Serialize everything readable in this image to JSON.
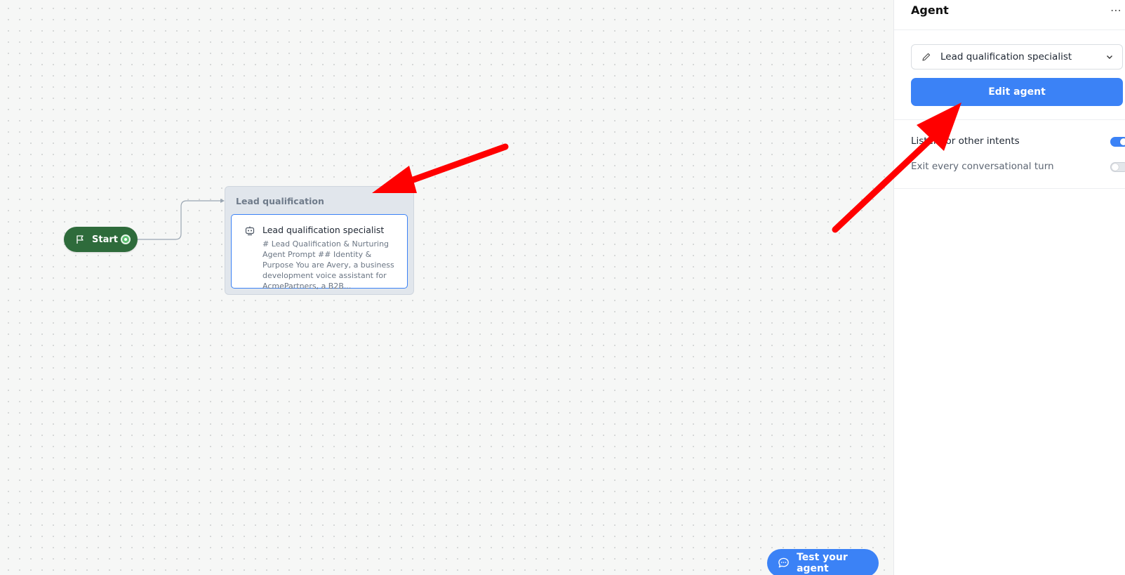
{
  "canvas": {
    "start_node": {
      "label": "Start"
    },
    "group_node": {
      "title": "Lead qualification",
      "agent_card": {
        "name": "Lead qualification specialist",
        "description": "# Lead Qualification & Nurturing Agent Prompt ## Identity & Purpose You are Avery, a business development voice assistant for AcmePartners, a B2B..."
      }
    },
    "test_button": {
      "label": "Test your agent",
      "icon": "chat-bubble-icon"
    }
  },
  "panel": {
    "title": "Agent",
    "more_label": "⋯",
    "agent_select": {
      "value": "Lead qualification specialist",
      "icon": "pencil-icon"
    },
    "edit_button": {
      "label": "Edit agent"
    },
    "toggles": [
      {
        "label": "Listen for other intents",
        "on": true
      },
      {
        "label": "Exit every conversational turn",
        "on": false
      }
    ]
  },
  "colors": {
    "accent": "#3b82f6",
    "start_green": "#2e6b3b",
    "annotation_red": "#ff0000"
  }
}
